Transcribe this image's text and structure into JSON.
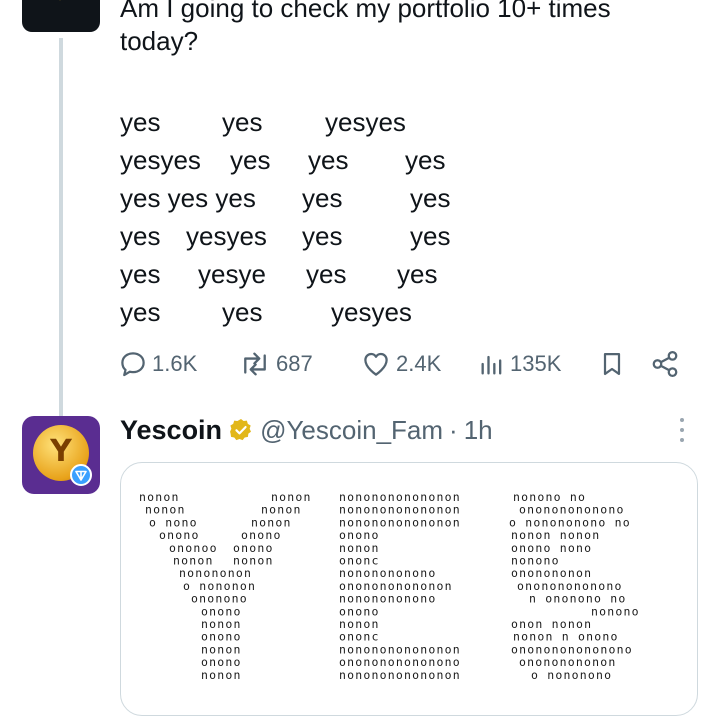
{
  "thread": {
    "tweet_lines": [
      "Am I going to check my portfolio 10+ times",
      "today?"
    ],
    "yes_art": [
      [
        "yes",
        "yes",
        "yesyes"
      ],
      [
        "yesyes",
        "yes",
        "yes",
        "yes"
      ],
      [
        "yes yes yes",
        "yes",
        "yes"
      ],
      [
        "yes",
        "yesyes",
        "yes",
        "yes"
      ],
      [
        "yes",
        "yesye",
        "yes",
        "yes"
      ],
      [
        "yes",
        "yes",
        "yesyes"
      ]
    ],
    "actions": {
      "replies": "1.6K",
      "reposts": "687",
      "likes": "2.4K",
      "views": "135K"
    }
  },
  "reply": {
    "display_name": "Yescoin",
    "handle": "@Yescoin_Fam",
    "separator": "·",
    "time": "1h",
    "avatar_letter": "Y",
    "card_art": [
      [
        "nonon",
        "nonon",
        "nononononononon",
        "nonono no"
      ],
      [
        "nonon",
        "nonon",
        "nononononononon",
        "onononononono"
      ],
      [
        "o nono",
        "nonon",
        "nononononononon",
        "o nonononono no"
      ],
      [
        "onono",
        "onono",
        "onono",
        "nonon    nonon"
      ],
      [
        "ononoo",
        "onono",
        "nonon",
        "onono     nono"
      ],
      [
        "nonon",
        "nonon",
        "ononc",
        "nonono"
      ],
      [
        "nonononon",
        "",
        "nononononono",
        "ononononon"
      ],
      [
        "o nononon",
        "",
        "ononononononon",
        "onononononono"
      ],
      [
        "ononono",
        "",
        "nononononono",
        "n ononono no"
      ],
      [
        "onono",
        "",
        "onono",
        "nonono"
      ],
      [
        "nonon",
        "",
        "nonon",
        "onon     nonon"
      ],
      [
        "onono",
        "",
        "ononc",
        "nonon   n onono"
      ],
      [
        "nonon",
        "",
        "nononononononon",
        "ononononononono"
      ],
      [
        "onono",
        "",
        "ononononononono",
        "onononononon"
      ],
      [
        "nonon",
        "",
        "nononononononon",
        "o nononono"
      ]
    ]
  },
  "colors": {
    "text": "#0f1419",
    "secondary": "#536471",
    "border": "#cfd9de",
    "verified_gold": "#e2b719",
    "avatar_purple": "#5a2d91",
    "coin_gold": "#f3ba2f"
  },
  "icons": [
    "reply-icon",
    "repost-icon",
    "like-icon",
    "views-icon",
    "bookmark-icon",
    "share-icon",
    "verified-badge-icon",
    "more-icon"
  ]
}
